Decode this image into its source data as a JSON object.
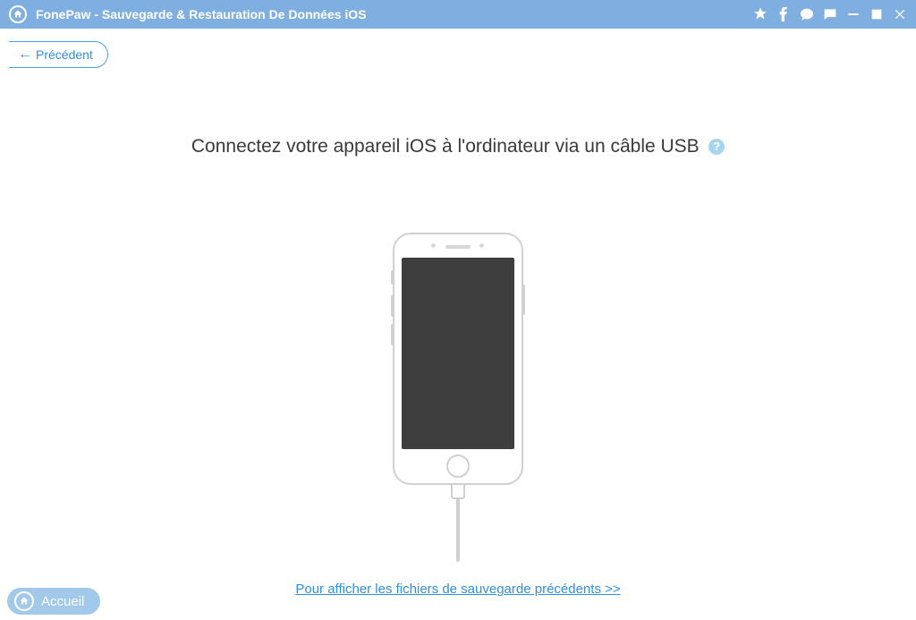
{
  "titlebar": {
    "title": "FonePaw - Sauvegarde & Restauration De Données iOS"
  },
  "nav": {
    "back_label": "Précédent",
    "home_label": "Accueil"
  },
  "main": {
    "instruction": "Connectez votre appareil iOS à l'ordinateur via un câble USB",
    "help_glyph": "?",
    "view_backups_link": "Pour afficher les fichiers de sauvegarde précédents >>"
  },
  "colors": {
    "accent": "#7fafe0",
    "link": "#2f8fe0"
  }
}
